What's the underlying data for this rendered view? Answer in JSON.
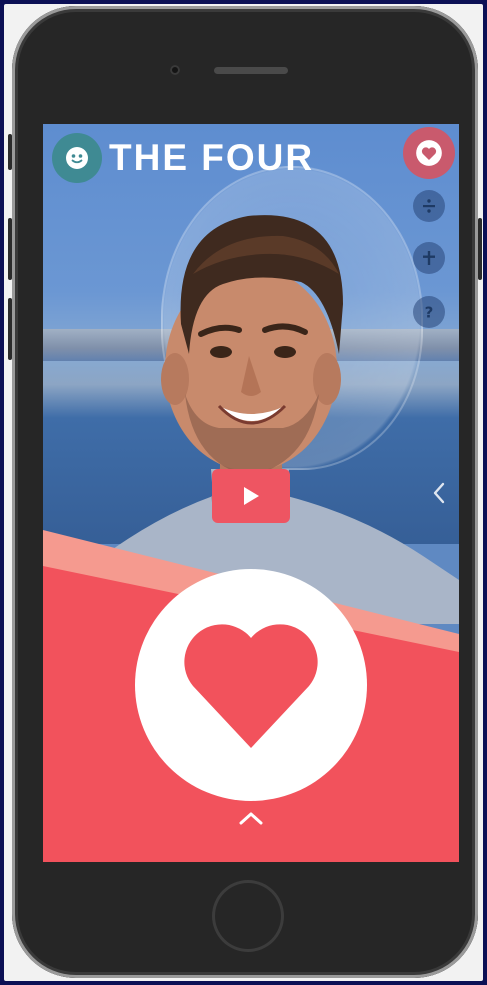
{
  "app": {
    "title": "THE FOUR"
  },
  "topbar": {
    "logo_icon": "smiley-face-icon",
    "favorite_icon": "heart-icon"
  },
  "side_menu": [
    {
      "icon": "divide-icon"
    },
    {
      "icon": "plus-icon"
    },
    {
      "icon": "question-icon"
    }
  ],
  "video": {
    "play_icon": "play-icon",
    "back_icon": "chevron-left-icon"
  },
  "vote": {
    "like_icon": "heart-icon",
    "expand_icon": "chevron-up-icon"
  },
  "colors": {
    "accent": "#f2525c",
    "accent_light": "#f59a8f",
    "logo_teal": "#3f8a93",
    "favorite_pink": "#c95a6d"
  }
}
